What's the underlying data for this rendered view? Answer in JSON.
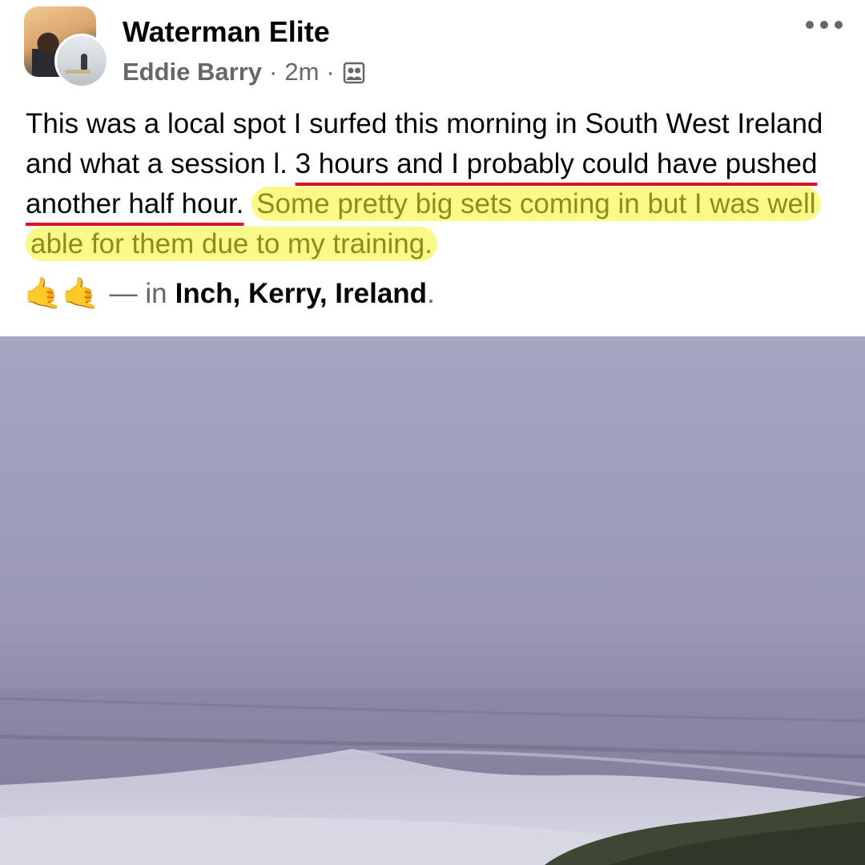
{
  "post": {
    "group_name": "Waterman Elite",
    "author": "Eddie Barry",
    "time": "2m",
    "separator": "·",
    "more_icon": "more-horizontal-icon",
    "audience_icon": "group-members-icon"
  },
  "body": {
    "text_part1": "This was a local spot I surfed this morning in South West Ireland and what a session l.",
    "text_underlined": "3 hours and I probably could have pushed another half hour.",
    "text_highlighted": "Some pretty big sets coming in but I was well able for them due to my training.",
    "emojis": "🤙🤙",
    "location_prefix": "— in",
    "location": "Inch, Kerry, Ireland",
    "location_suffix": "."
  },
  "colors": {
    "underline": "#e0141e",
    "highlight": "#fbfa88",
    "highlight_text": "#8a8f1a",
    "secondary_text": "#65676b"
  }
}
